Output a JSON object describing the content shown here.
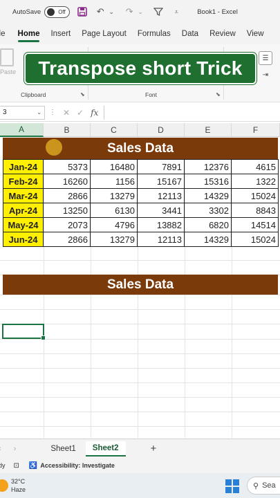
{
  "titlebar": {
    "autosave_label": "AutoSave",
    "autosave_state": "Off",
    "document_title": "Book1  -  Excel"
  },
  "ribbon": {
    "tabs": [
      {
        "label": "ile",
        "active": false
      },
      {
        "label": "Home",
        "active": true
      },
      {
        "label": "Insert",
        "active": false
      },
      {
        "label": "Page Layout",
        "active": false
      },
      {
        "label": "Formulas",
        "active": false
      },
      {
        "label": "Data",
        "active": false
      },
      {
        "label": "Review",
        "active": false
      },
      {
        "label": "View",
        "active": false
      }
    ],
    "paste_label": "Paste",
    "clipboard_label": "Clipboard",
    "font_label": "Font",
    "launcher_glyph": "⬊"
  },
  "banner": {
    "text": "Transpose short Trick"
  },
  "formula_bar": {
    "name_box": "3",
    "fx": "fx"
  },
  "grid": {
    "columns": [
      "A",
      "B",
      "C",
      "D",
      "E",
      "F"
    ],
    "selected_column": "A",
    "header_title": "Sales Data",
    "second_title": "Sales Data",
    "rows": [
      {
        "month": "Jan-24",
        "values": [
          "5373",
          "16480",
          "7891",
          "12376",
          "4615"
        ]
      },
      {
        "month": "Feb-24",
        "values": [
          "16260",
          "1156",
          "15167",
          "15316",
          "1322"
        ]
      },
      {
        "month": "Mar-24",
        "values": [
          "2866",
          "13279",
          "12113",
          "14329",
          "15024"
        ]
      },
      {
        "month": "Apr-24",
        "values": [
          "13250",
          "6130",
          "3441",
          "3302",
          "8843"
        ]
      },
      {
        "month": "May-24",
        "values": [
          "2073",
          "4796",
          "13882",
          "6820",
          "14514"
        ]
      },
      {
        "month": "Jun-24",
        "values": [
          "2866",
          "13279",
          "12113",
          "14329",
          "15024"
        ]
      }
    ]
  },
  "sheets": {
    "tabs": [
      "Sheet1",
      "Sheet2"
    ],
    "active": "Sheet2",
    "add_label": "+"
  },
  "status": {
    "ready": "dy",
    "accessibility": "Accessibility: Investigate"
  },
  "taskbar": {
    "temperature": "32°C",
    "condition": "Haze",
    "search_label": "Sea"
  },
  "colors": {
    "excel_green": "#1a7343",
    "banner_green": "#1f6f30",
    "brown_header": "#7b3a0a",
    "month_yellow": "#ffef00"
  }
}
